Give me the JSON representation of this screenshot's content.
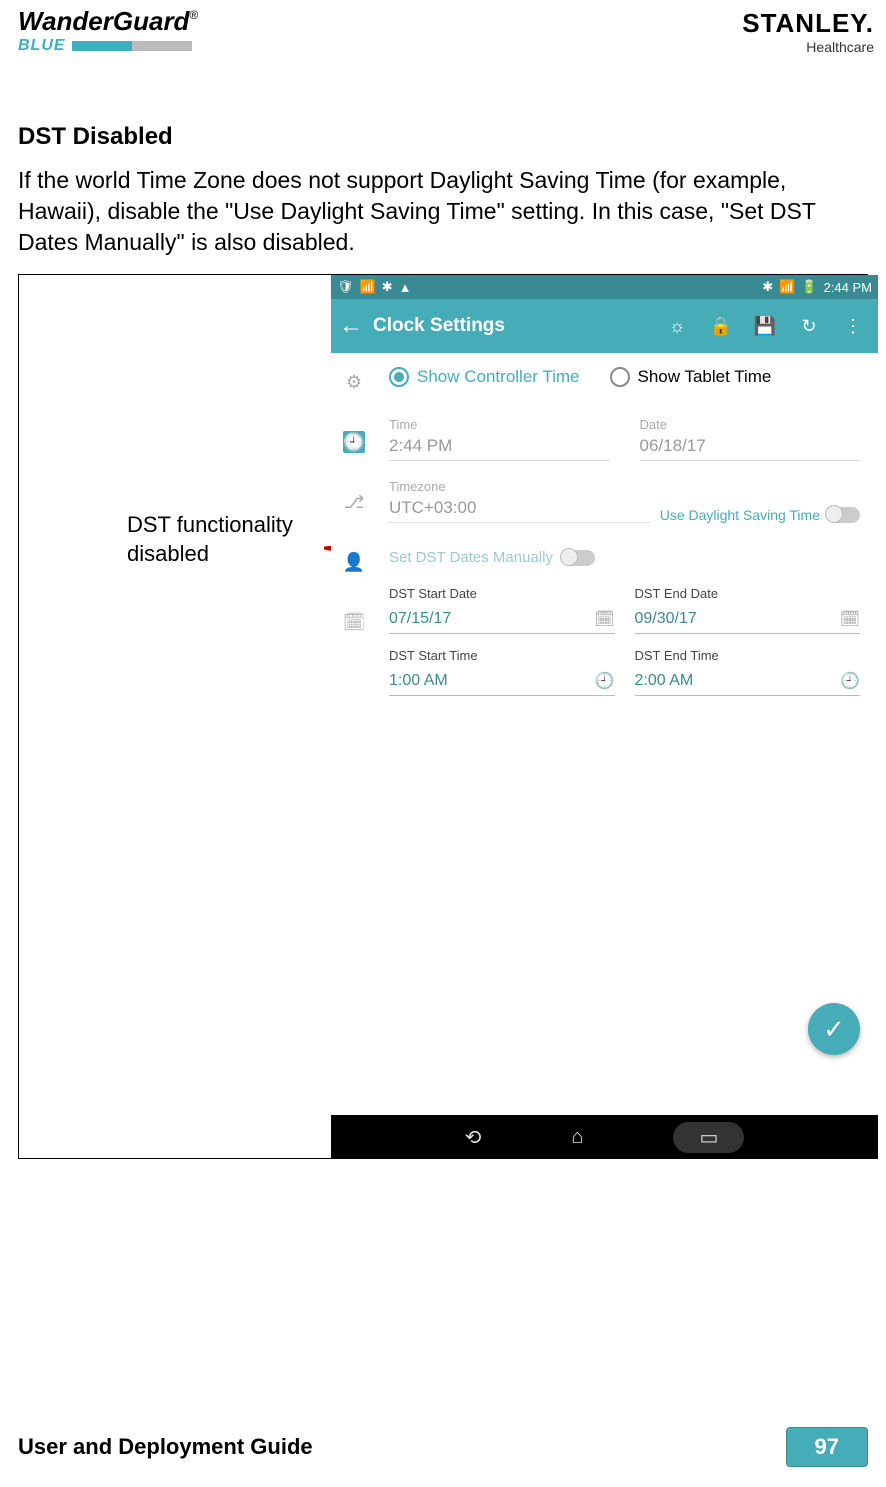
{
  "header": {
    "logo_main": "WanderGuard",
    "logo_reg": "®",
    "logo_sub": "BLUE",
    "brand_main": "STANLEY",
    "brand_sub": "Healthcare",
    "brand_dot": "."
  },
  "section": {
    "title": "DST Disabled",
    "body": "If the world Time Zone does not support Daylight Saving Time (for example, Hawaii), disable the \"Use Daylight Saving Time\" setting. In this case, \"Set DST Dates Manually\" is also disabled."
  },
  "callout": {
    "line1": "DST functionality",
    "line2": "disabled"
  },
  "phone": {
    "status_time": "2:44 PM",
    "appbar_title": "Clock Settings",
    "radio_controller": "Show Controller Time",
    "radio_tablet": "Show Tablet Time",
    "time_label": "Time",
    "time_value": "2:44 PM",
    "date_label": "Date",
    "date_value": "06/18/17",
    "tz_label": "Timezone",
    "tz_value": "UTC+03:00",
    "dst_toggle_label": "Use Daylight Saving Time",
    "manual_label": "Set DST Dates Manually",
    "dst_start_date_label": "DST Start Date",
    "dst_start_date_value": "07/15/17",
    "dst_end_date_label": "DST End Date",
    "dst_end_date_value": "09/30/17",
    "dst_start_time_label": "DST Start Time",
    "dst_start_time_value": "1:00 AM",
    "dst_end_time_label": "DST End Time",
    "dst_end_time_value": "2:00 AM"
  },
  "footer": {
    "title": "User and Deployment Guide",
    "page": "97"
  }
}
